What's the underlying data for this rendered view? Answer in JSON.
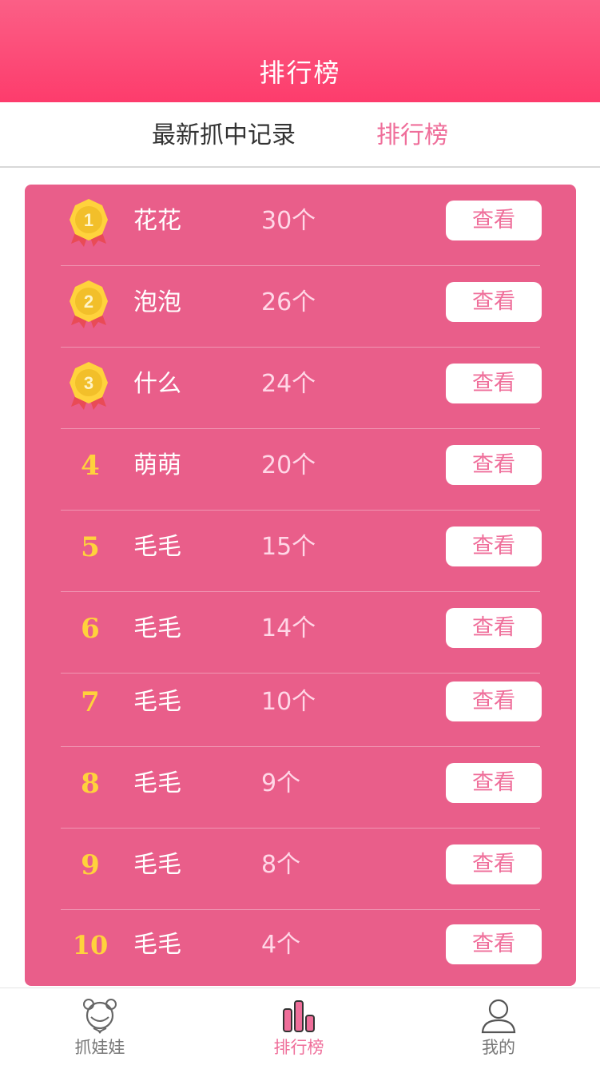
{
  "header": {
    "title": "排行榜"
  },
  "tabs": [
    {
      "label": "最新抓中记录",
      "active": false
    },
    {
      "label": "排行榜",
      "active": true
    }
  ],
  "ranking": [
    {
      "rank": "1",
      "medal": "gold-medal",
      "name": "花花",
      "count": "30个",
      "action": "查看"
    },
    {
      "rank": "2",
      "medal": "gold-medal",
      "name": "泡泡",
      "count": "26个",
      "action": "查看"
    },
    {
      "rank": "3",
      "medal": "gold-medal",
      "name": "什么",
      "count": "24个",
      "action": "查看"
    },
    {
      "rank": "4",
      "name": "萌萌",
      "count": "20个",
      "action": "查看"
    },
    {
      "rank": "5",
      "name": "毛毛",
      "count": "15个",
      "action": "查看"
    },
    {
      "rank": "6",
      "name": "毛毛",
      "count": "14个",
      "action": "查看"
    },
    {
      "rank": "7",
      "name": "毛毛",
      "count": "10个",
      "action": "查看"
    },
    {
      "rank": "8",
      "name": "毛毛",
      "count": "9个",
      "action": "查看"
    },
    {
      "rank": "9",
      "name": "毛毛",
      "count": "8个",
      "action": "查看"
    },
    {
      "rank": "10",
      "name": "毛毛",
      "count": "4个",
      "action": "查看"
    }
  ],
  "tabbar": [
    {
      "label": "抓娃娃",
      "icon": "doll-icon",
      "active": false
    },
    {
      "label": "排行榜",
      "icon": "ranking-icon",
      "active": true
    },
    {
      "label": "我的",
      "icon": "user-icon",
      "active": false
    }
  ],
  "colors": {
    "header": "#fd4a76",
    "panel": "#e95e8a",
    "accent": "#ef6e9a",
    "count_text": "#ffd7e7",
    "name_text": "#ffffff",
    "rank_number": "#ffd23c"
  }
}
